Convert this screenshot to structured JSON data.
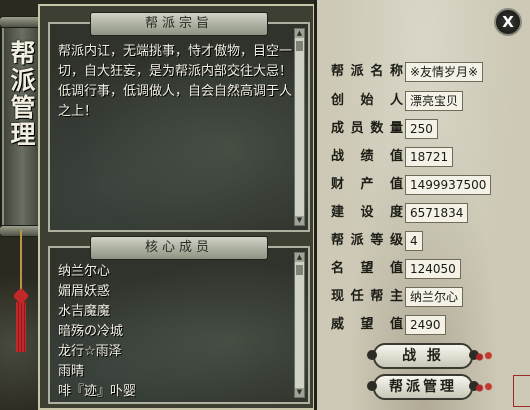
{
  "sidebar": {
    "title": "帮派管理"
  },
  "purpose_panel": {
    "title": "帮派宗旨",
    "text": "帮派内讧，无端挑事，恃才傲物，目空一切，自大狂妄，是为帮派内部交往大忌！低调行事，低调做人，自会自然高调于人之上！"
  },
  "members_panel": {
    "title": "核心成员",
    "members": [
      "纳兰尔心",
      "媚眉妖惑",
      "水吉魔魔",
      "暗殇の冷城",
      "龙行☆雨泽",
      "雨晴",
      "啡『迹』卟婴"
    ]
  },
  "info": [
    {
      "label": "帮派名称",
      "value": "※友情岁月※"
    },
    {
      "label": "创始人",
      "value": "漂亮宝贝"
    },
    {
      "label": "成员数量",
      "value": "250"
    },
    {
      "label": "战绩值",
      "value": "18721"
    },
    {
      "label": "财产值",
      "value": "1499937500"
    },
    {
      "label": "建设度",
      "value": "6571834"
    },
    {
      "label": "帮派等级",
      "value": "4"
    },
    {
      "label": "名望值",
      "value": "124050"
    },
    {
      "label": "现任帮主",
      "value": "纳兰尔心"
    },
    {
      "label": "威望值",
      "value": "2490"
    }
  ],
  "buttons": {
    "battle": "战 报",
    "manage": "帮派管理",
    "close": "X"
  },
  "seal_text": "帮派"
}
